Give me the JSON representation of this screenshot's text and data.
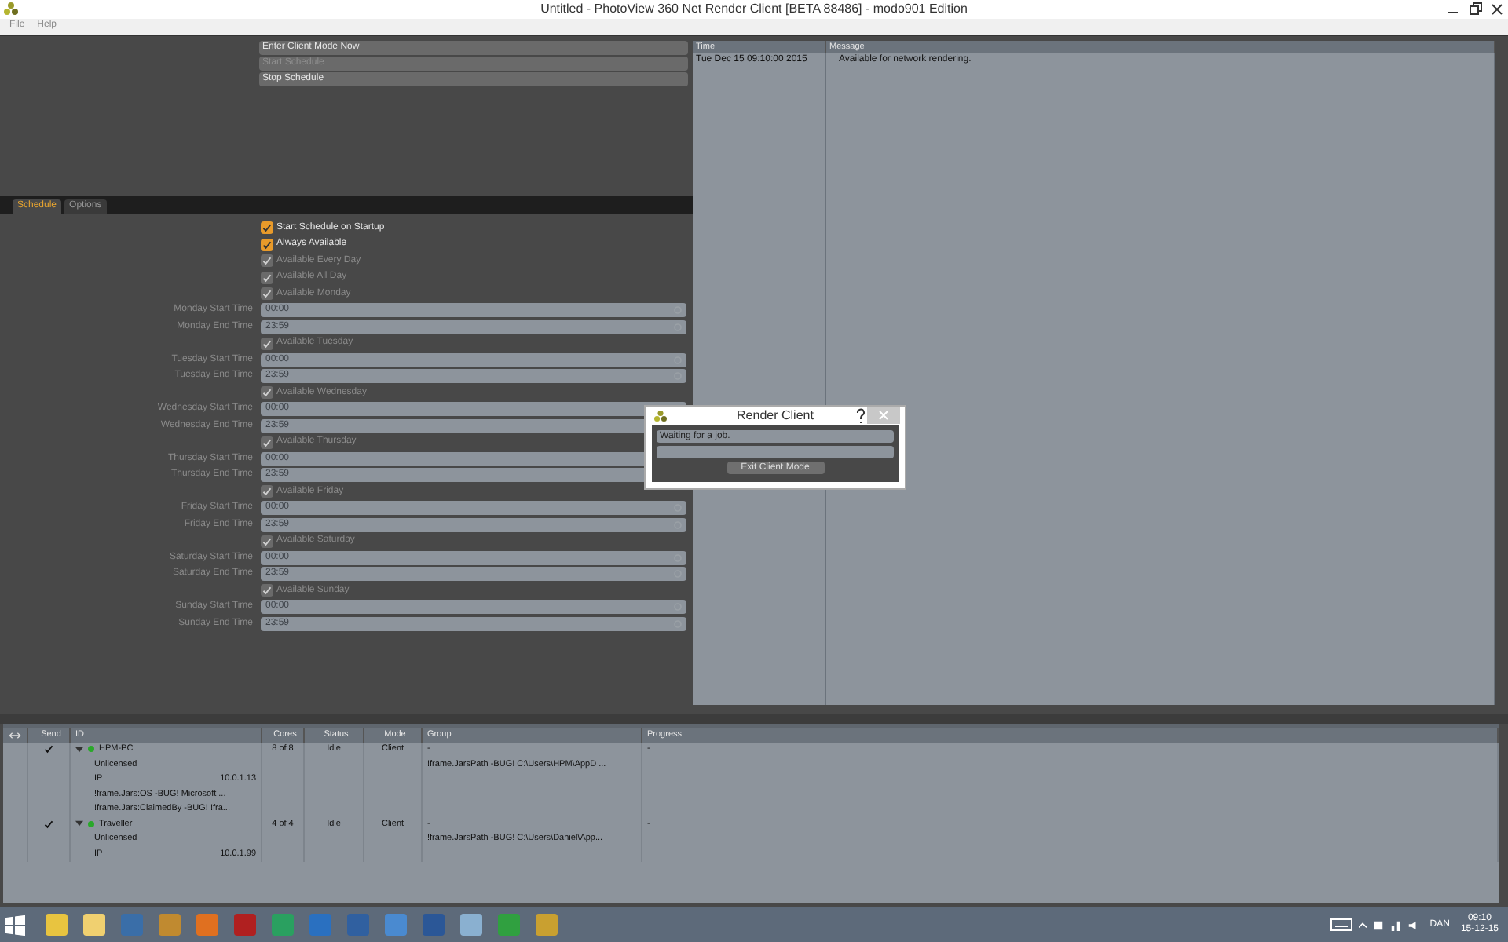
{
  "window": {
    "title": "Untitled - PhotoView 360 Net Render Client [BETA 88486] - modo901 Edition"
  },
  "menu": [
    "File",
    "Help"
  ],
  "actions": [
    {
      "label": "Enter Client Mode Now",
      "disabled": false
    },
    {
      "label": "Start Schedule",
      "disabled": true
    },
    {
      "label": "Stop Schedule",
      "disabled": false
    }
  ],
  "tabs": [
    {
      "label": "Schedule",
      "selected": true
    },
    {
      "label": "Options",
      "selected": false
    }
  ],
  "schedule": [
    {
      "kind": "checkbox",
      "label": "Start Schedule on Startup",
      "checked": true,
      "disabled": false
    },
    {
      "kind": "checkbox",
      "label": "Always Available",
      "checked": true,
      "disabled": false
    },
    {
      "kind": "checkbox",
      "label": "Available Every Day",
      "checked": true,
      "disabled": true
    },
    {
      "kind": "checkbox",
      "label": "Available All Day",
      "checked": true,
      "disabled": true
    },
    {
      "kind": "checkbox",
      "label": "Available Monday",
      "checked": true,
      "disabled": true
    },
    {
      "kind": "time",
      "label": "Monday Start Time",
      "value": "00:00"
    },
    {
      "kind": "time",
      "label": "Monday End Time",
      "value": "23:59"
    },
    {
      "kind": "checkbox",
      "label": "Available Tuesday",
      "checked": true,
      "disabled": true
    },
    {
      "kind": "time",
      "label": "Tuesday Start Time",
      "value": "00:00"
    },
    {
      "kind": "time",
      "label": "Tuesday End Time",
      "value": "23:59"
    },
    {
      "kind": "checkbox",
      "label": "Available Wednesday",
      "checked": true,
      "disabled": true
    },
    {
      "kind": "time",
      "label": "Wednesday Start Time",
      "value": "00:00"
    },
    {
      "kind": "time",
      "label": "Wednesday End Time",
      "value": "23:59"
    },
    {
      "kind": "checkbox",
      "label": "Available Thursday",
      "checked": true,
      "disabled": true
    },
    {
      "kind": "time",
      "label": "Thursday Start Time",
      "value": "00:00"
    },
    {
      "kind": "time",
      "label": "Thursday End Time",
      "value": "23:59"
    },
    {
      "kind": "checkbox",
      "label": "Available Friday",
      "checked": true,
      "disabled": true
    },
    {
      "kind": "time",
      "label": "Friday Start Time",
      "value": "00:00"
    },
    {
      "kind": "time",
      "label": "Friday End Time",
      "value": "23:59"
    },
    {
      "kind": "checkbox",
      "label": "Available Saturday",
      "checked": true,
      "disabled": true
    },
    {
      "kind": "time",
      "label": "Saturday Start Time",
      "value": "00:00"
    },
    {
      "kind": "time",
      "label": "Saturday End Time",
      "value": "23:59"
    },
    {
      "kind": "checkbox",
      "label": "Available Sunday",
      "checked": true,
      "disabled": true
    },
    {
      "kind": "time",
      "label": "Sunday Start Time",
      "value": "00:00"
    },
    {
      "kind": "time",
      "label": "Sunday End Time",
      "value": "23:59"
    }
  ],
  "log": {
    "columns": [
      "Time",
      "Message"
    ],
    "rows": [
      [
        "Tue Dec 15 09:10:00 2015",
        "Available for network rendering."
      ]
    ]
  },
  "dialog": {
    "title": "Render Client",
    "status": "Waiting for a job.",
    "button": "Exit Client Mode"
  },
  "clients": {
    "columns": [
      "Send",
      "ID",
      "Cores",
      "Status",
      "Mode",
      "Group",
      "Progress"
    ],
    "rows": [
      {
        "send": true,
        "expanded": true,
        "online": true,
        "id": "HPM-PC",
        "cores": "8 of 8",
        "status": "Idle",
        "mode": "Client",
        "group": "-",
        "progress": "-",
        "children": [
          {
            "label": "Unlicensed",
            "group": "!frame.JarsPath -BUG!  C:\\Users\\HPM\\AppD ..."
          },
          {
            "label": "IP",
            "value": "10.0.1.13"
          },
          {
            "label": "!frame.Jars:OS -BUG!  Microsoft  ..."
          },
          {
            "label": "!frame.Jars:ClaimedBy -BUG!  !fra..."
          }
        ]
      },
      {
        "send": true,
        "expanded": true,
        "online": true,
        "id": "Traveller",
        "cores": "4 of 4",
        "status": "Idle",
        "mode": "Client",
        "group": "-",
        "progress": "-",
        "children": [
          {
            "label": "Unlicensed",
            "group": "!frame.JarsPath -BUG!  C:\\Users\\Daniel\\App..."
          },
          {
            "label": "IP",
            "value": "10.0.1.99"
          }
        ]
      }
    ]
  },
  "taskbar": {
    "language": "DAN",
    "time": "09:10",
    "date": "15-12-15"
  }
}
